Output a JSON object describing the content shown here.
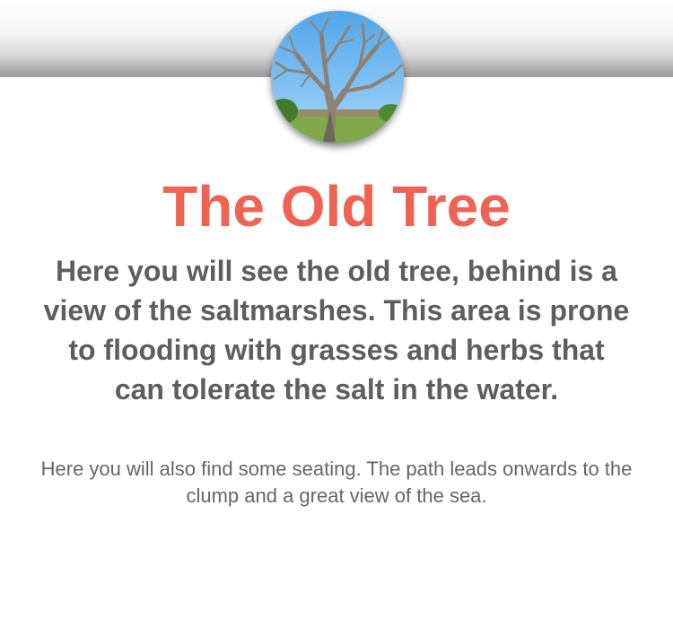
{
  "page": {
    "title": "The Old Tree",
    "lead_text": "Here you will see the old tree, behind is a view of the saltmarshes. This area is prone to flooding with grasses and herbs that can tolerate the salt in the water.",
    "sub_text": "Here you will also find some seating. The path leads onwards to the clump and a great view of the sea."
  },
  "image": {
    "icon": "tree-photo"
  },
  "colors": {
    "title": "#f06352",
    "body_text": "#5e5e5e",
    "sub_text": "#666666",
    "header_band_shadow": "#9a9a9a",
    "sky": "#6db8f0"
  }
}
